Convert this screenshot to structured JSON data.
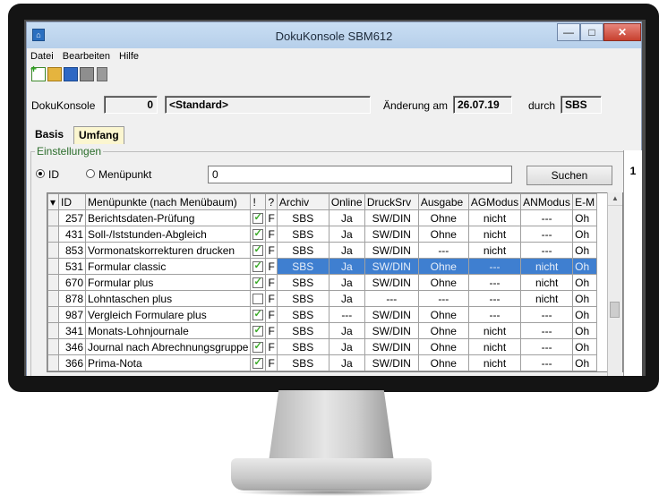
{
  "window": {
    "title": "DokuKonsole SBM612",
    "controls": {
      "minimize": "—",
      "maximize": "□",
      "close": "✕"
    }
  },
  "menu": [
    "Datei",
    "Bearbeiten",
    "Hilfe"
  ],
  "toolbar": [
    "new-icon",
    "open-icon",
    "save-icon",
    "print-icon",
    "delete-icon"
  ],
  "header": {
    "label": "DokuKonsole",
    "number": "0",
    "profile": "<Standard>",
    "changed_label": "Änderung am",
    "changed_date": "26.07.19",
    "by_label": "durch",
    "by_user": "SBS"
  },
  "tabs": [
    {
      "label": "Basis",
      "active": false
    },
    {
      "label": "Umfang",
      "active": true
    }
  ],
  "settings": {
    "legend": "Einstellungen",
    "radio_id": "ID",
    "radio_menu": "Menüpunkt",
    "search_value": "0",
    "search_button": "Suchen",
    "page": "1"
  },
  "grid": {
    "columns": [
      "ID",
      "Menüpunkte (nach Menübaum)",
      "!",
      "?",
      "Archiv",
      "Online",
      "DruckSrv",
      "Ausgabe",
      "AGModus",
      "ANModus",
      "E-M"
    ],
    "rows": [
      {
        "id": "257",
        "name": "Berichtsdaten-Prüfung",
        "chk": true,
        "q": "F",
        "archiv": "SBS",
        "online": "Ja",
        "druck": "SW/DIN",
        "ausgabe": "Ohne",
        "ag": "nicht",
        "an": "---",
        "em": "Oh"
      },
      {
        "id": "431",
        "name": "Soll-/Iststunden-Abgleich",
        "chk": true,
        "q": "F",
        "archiv": "SBS",
        "online": "Ja",
        "druck": "SW/DIN",
        "ausgabe": "Ohne",
        "ag": "nicht",
        "an": "---",
        "em": "Oh"
      },
      {
        "id": "853",
        "name": "Vormonatskorrekturen drucken",
        "chk": true,
        "q": "F",
        "archiv": "SBS",
        "online": "Ja",
        "druck": "SW/DIN",
        "ausgabe": "---",
        "ag": "nicht",
        "an": "---",
        "em": "Oh"
      },
      {
        "id": "531",
        "name": "Formular classic",
        "chk": true,
        "q": "F",
        "archiv": "SBS",
        "online": "Ja",
        "druck": "SW/DIN",
        "ausgabe": "Ohne",
        "ag": "---",
        "an": "nicht",
        "em": "Oh",
        "selected": true
      },
      {
        "id": "670",
        "name": "Formular plus",
        "chk": true,
        "q": "F",
        "archiv": "SBS",
        "online": "Ja",
        "druck": "SW/DIN",
        "ausgabe": "Ohne",
        "ag": "---",
        "an": "nicht",
        "em": "Oh"
      },
      {
        "id": "878",
        "name": "Lohntaschen plus",
        "chk": false,
        "q": "F",
        "archiv": "SBS",
        "online": "Ja",
        "druck": "---",
        "ausgabe": "---",
        "ag": "---",
        "an": "nicht",
        "em": "Oh"
      },
      {
        "id": "987",
        "name": "Vergleich Formulare plus",
        "chk": true,
        "q": "F",
        "archiv": "SBS",
        "online": "---",
        "druck": "SW/DIN",
        "ausgabe": "Ohne",
        "ag": "---",
        "an": "---",
        "em": "Oh"
      },
      {
        "id": "341",
        "name": "Monats-Lohnjournale",
        "chk": true,
        "q": "F",
        "archiv": "SBS",
        "online": "Ja",
        "druck": "SW/DIN",
        "ausgabe": "Ohne",
        "ag": "nicht",
        "an": "---",
        "em": "Oh"
      },
      {
        "id": "346",
        "name": "Journal nach Abrechnungsgruppe",
        "chk": true,
        "q": "F",
        "archiv": "SBS",
        "online": "Ja",
        "druck": "SW/DIN",
        "ausgabe": "Ohne",
        "ag": "nicht",
        "an": "---",
        "em": "Oh"
      },
      {
        "id": "366",
        "name": "Prima-Nota",
        "chk": true,
        "q": "F",
        "archiv": "SBS",
        "online": "Ja",
        "druck": "SW/DIN",
        "ausgabe": "Ohne",
        "ag": "nicht",
        "an": "---",
        "em": "Oh"
      }
    ]
  },
  "colors": {
    "selection": "#3f7fd0",
    "tab_active": "#fbf6d0",
    "check": "#3cab2a"
  }
}
